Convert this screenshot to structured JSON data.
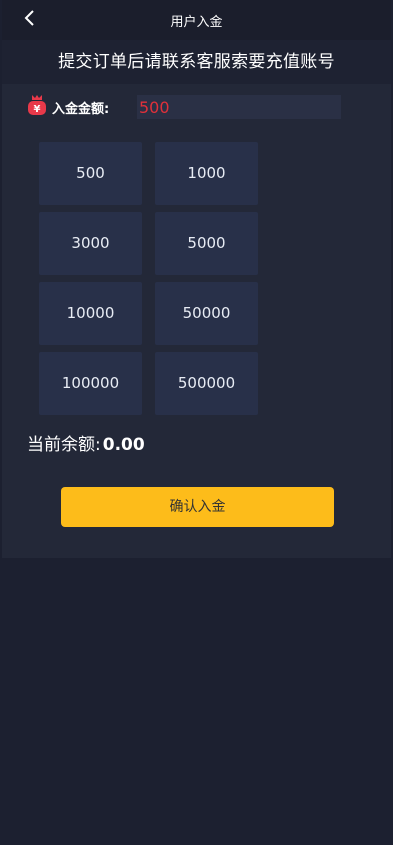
{
  "header": {
    "title": "用户入金"
  },
  "notice": "提交订单后请联系客服索要充值账号",
  "amount": {
    "label": "入金金额:",
    "value": "500"
  },
  "options": [
    "500",
    "1000",
    "3000",
    "5000",
    "10000",
    "50000",
    "100000",
    "500000"
  ],
  "balance": {
    "label": "当前余额:",
    "value": "0.00"
  },
  "confirm_label": "确认入金",
  "colors": {
    "accent": "#fdbc1a",
    "amount_text": "#e0303a",
    "icon": "#e8394a",
    "background": "#1c2030",
    "panel": "#232838",
    "option_bg": "#283049"
  },
  "icons": {
    "back": "chevron-left-icon",
    "amount": "money-bag-icon"
  }
}
